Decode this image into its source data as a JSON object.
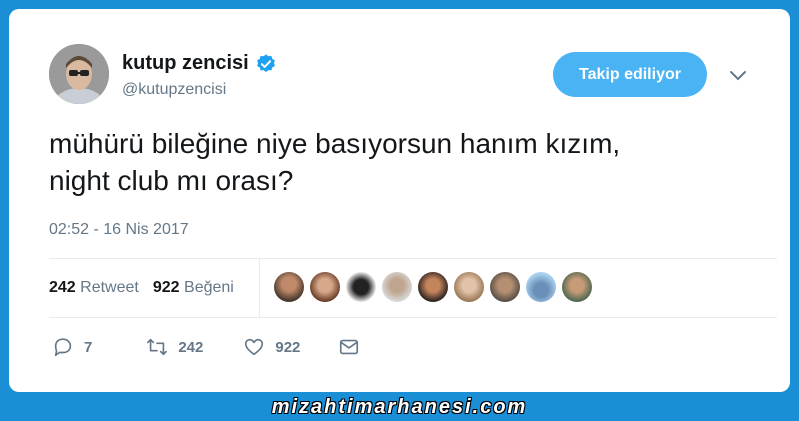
{
  "author": {
    "name": "kutup zencisi",
    "handle": "@kutupzencisi",
    "verified": true
  },
  "follow_button_label": "Takip ediliyor",
  "tweet": {
    "line1": "mühürü bileğine niye basıyorsun hanım kızım,",
    "line2": "night club mı orası?",
    "timestamp": "02:52 - 16 Nis 2017"
  },
  "stats": {
    "retweet_count": "242",
    "retweet_label": "Retweet",
    "like_count": "922",
    "like_label": "Beğeni"
  },
  "actions": {
    "reply_count": "7",
    "retweet_count": "242",
    "like_count": "922"
  },
  "colors": {
    "accent": "#1da1f2",
    "follow_button": "#4ab3f4",
    "background": "#1a8fd6"
  },
  "watermark": "mizahtimarhanesi.com"
}
